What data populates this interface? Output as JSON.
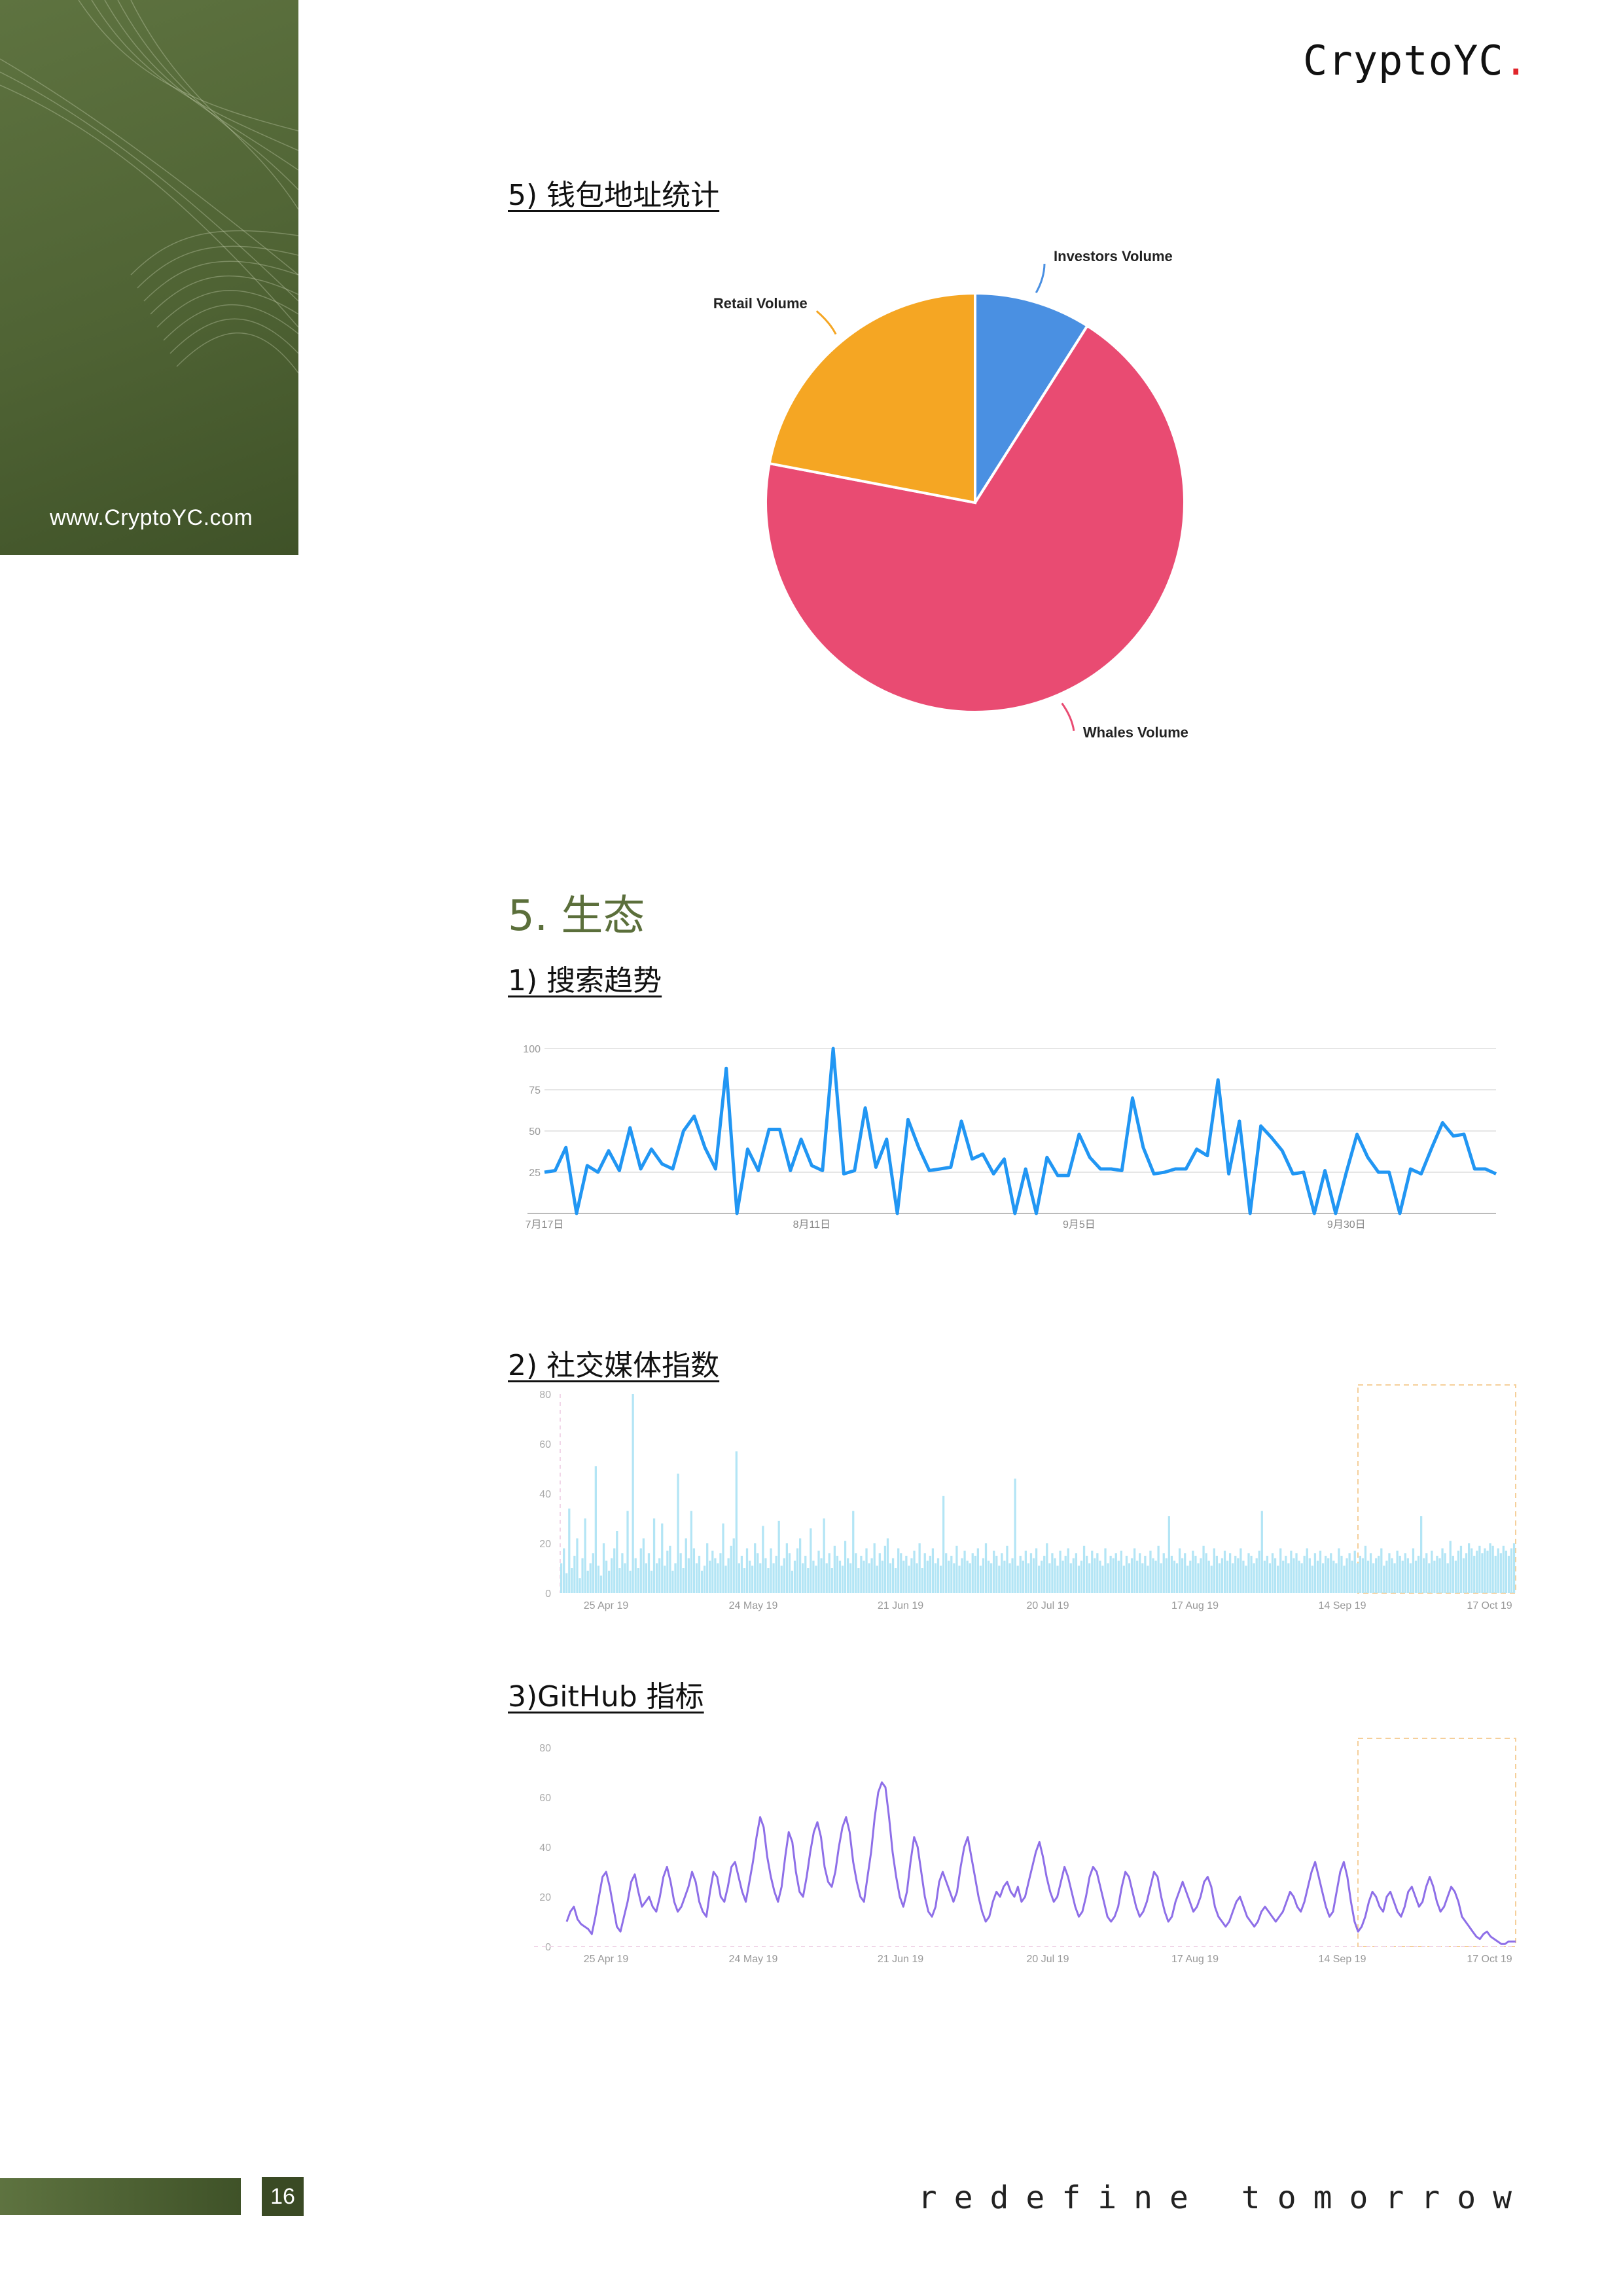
{
  "header": {
    "logo_text": "CryptoYC",
    "logo_dot": "."
  },
  "sidebar": {
    "url": "www.CryptoYC.com"
  },
  "sections": {
    "wallet_heading": "5) 钱包地址统计",
    "ecosystem_title": "5. 生态",
    "search_heading": "1) 搜索趋势",
    "social_heading": "2) 社交媒体指数",
    "github_heading": "3)GitHub 指标"
  },
  "footer": {
    "page_number": "16",
    "tagline": "redefine tomorrow"
  },
  "colors": {
    "brand_green": "#5b6f3b",
    "investors": "#4a90e2",
    "whales": "#e94b72",
    "retail": "#f5a623",
    "search_line": "#2196f3",
    "social_bars": "#b3e5f5",
    "github_line": "#8e6fe8",
    "highlight_box": "#f5cf9a"
  },
  "chart_data": [
    {
      "type": "pie",
      "title": "",
      "slices": [
        {
          "label": "Investors Volume",
          "value": 9
        },
        {
          "label": "Whales Volume",
          "value": 69
        },
        {
          "label": "Retail Volume",
          "value": 22
        }
      ],
      "legend": "none"
    },
    {
      "type": "line",
      "title": "",
      "xlabel": "",
      "ylabel": "",
      "ylim": [
        0,
        100
      ],
      "yticks": [
        "100",
        "75",
        "50",
        "25"
      ],
      "xtick_labels": [
        {
          "label": "7月17日",
          "index": 0
        },
        {
          "label": "8月11日",
          "index": 25
        },
        {
          "label": "9月5日",
          "index": 50
        },
        {
          "label": "9月30日",
          "index": 75
        }
      ],
      "grid": true,
      "series": [
        {
          "values": [
            25,
            26,
            40,
            0,
            29,
            25,
            38,
            26,
            52,
            27,
            39,
            30,
            27,
            50,
            59,
            40,
            27,
            88,
            0,
            39,
            26,
            51,
            51,
            26,
            45,
            29,
            26,
            100,
            24,
            26,
            64,
            28,
            45,
            0,
            57,
            40,
            26,
            27,
            28,
            56,
            33,
            36,
            24,
            33,
            0,
            27,
            0,
            34,
            23,
            23,
            48,
            34,
            27,
            27,
            26,
            70,
            40,
            24,
            25,
            27,
            27,
            39,
            35,
            81,
            24,
            56,
            0,
            53,
            46,
            38,
            24,
            25,
            0,
            26,
            0,
            25,
            48,
            34,
            25,
            25,
            0,
            27,
            24,
            40,
            55,
            47,
            48,
            27,
            27,
            24
          ]
        }
      ]
    },
    {
      "type": "bar",
      "title": "",
      "ylim": [
        0,
        80
      ],
      "yticks": [
        "80",
        "60",
        "40",
        "20",
        "0"
      ],
      "xtick_labels": [
        "25 Apr 19",
        "24 May 19",
        "21 Jun 19",
        "20 Jul 19",
        "17 Aug 19",
        "14 Sep 19",
        "17 Oct 19"
      ],
      "series": [
        {
          "values": [
            12,
            18,
            8,
            34,
            10,
            15,
            22,
            6,
            14,
            30,
            9,
            12,
            16,
            51,
            11,
            7,
            20,
            13,
            9,
            14,
            18,
            25,
            10,
            16,
            12,
            33,
            9,
            80,
            14,
            10,
            18,
            22,
            12,
            16,
            9,
            30,
            12,
            14,
            28,
            11,
            17,
            19,
            9,
            12,
            48,
            16,
            10,
            22,
            14,
            33,
            18,
            12,
            15,
            9,
            11,
            20,
            13,
            17,
            14,
            12,
            16,
            28,
            11,
            14,
            19,
            22,
            57,
            12,
            15,
            10,
            18,
            13,
            11,
            20,
            16,
            12,
            27,
            14,
            10,
            18,
            12,
            15,
            29,
            11,
            14,
            20,
            16,
            9,
            13,
            18,
            22,
            12,
            15,
            10,
            26,
            13,
            11,
            17,
            14,
            30,
            12,
            16,
            10,
            19,
            15,
            13,
            11,
            21,
            14,
            12,
            33,
            16,
            10,
            15,
            13,
            18,
            12,
            14,
            20,
            11,
            16,
            13,
            19,
            22,
            12,
            14,
            10,
            18,
            16,
            13,
            15,
            11,
            14,
            17,
            12,
            20,
            10,
            16,
            13,
            15,
            18,
            12,
            14,
            11,
            39,
            16,
            13,
            15,
            12,
            19,
            11,
            14,
            17,
            13,
            12,
            16,
            15,
            18,
            11,
            14,
            20,
            13,
            12,
            17,
            15,
            11,
            16,
            13,
            19,
            12,
            14,
            46,
            11,
            15,
            13,
            17,
            12,
            16,
            14,
            18,
            11,
            13,
            15,
            20,
            12,
            16,
            14,
            11,
            17,
            13,
            15,
            18,
            12,
            14,
            16,
            11,
            13,
            19,
            15,
            12,
            17,
            14,
            16,
            13,
            11,
            18,
            12,
            15,
            14,
            16,
            13,
            17,
            11,
            15,
            12,
            14,
            18,
            13,
            16,
            12,
            15,
            11,
            17,
            14,
            13,
            19,
            12,
            16,
            14,
            31,
            15,
            13,
            12,
            18,
            14,
            16,
            11,
            13,
            17,
            15,
            12,
            14,
            19,
            16,
            13,
            11,
            18,
            15,
            12,
            14,
            17,
            13,
            16,
            12,
            15,
            14,
            18,
            13,
            11,
            16,
            15,
            12,
            14,
            17,
            33,
            13,
            15,
            12,
            16,
            14,
            11,
            18,
            13,
            15,
            12,
            17,
            14,
            16,
            13,
            12,
            15,
            18,
            14,
            11,
            16,
            13,
            17,
            12,
            15,
            14,
            16,
            13,
            12,
            18,
            15,
            11,
            14,
            16,
            13,
            17,
            12,
            15,
            14,
            19,
            13,
            16,
            12,
            14,
            15,
            18,
            11,
            13,
            16,
            14,
            12,
            17,
            15,
            13,
            16,
            14,
            12,
            18,
            13,
            15,
            31,
            14,
            16,
            12,
            17,
            13,
            15,
            14,
            18,
            16,
            12,
            21,
            15,
            13,
            17,
            19,
            14,
            16,
            20,
            18,
            15,
            17,
            19,
            16,
            18,
            17,
            20,
            19,
            15,
            18,
            16,
            19,
            17,
            15,
            18,
            20
          ]
        }
      ],
      "highlight_region": {
        "from_label": "14 Sep 19",
        "to_label": "17 Oct 19"
      }
    },
    {
      "type": "line",
      "title": "",
      "ylim": [
        0,
        80
      ],
      "yticks": [
        "80",
        "60",
        "40",
        "20",
        "0"
      ],
      "xtick_labels": [
        "25 Apr 19",
        "24 May 19",
        "21 Jun 19",
        "20 Jul 19",
        "17 Aug 19",
        "14 Sep 19",
        "17 Oct 19"
      ],
      "series": [
        {
          "values": [
            10,
            14,
            16,
            11,
            9,
            8,
            7,
            5,
            12,
            20,
            28,
            30,
            24,
            16,
            8,
            6,
            12,
            18,
            26,
            29,
            22,
            16,
            18,
            20,
            16,
            14,
            20,
            28,
            32,
            26,
            18,
            14,
            16,
            20,
            24,
            30,
            26,
            18,
            14,
            12,
            22,
            30,
            28,
            20,
            18,
            24,
            32,
            34,
            28,
            22,
            18,
            26,
            34,
            44,
            52,
            48,
            36,
            28,
            22,
            18,
            24,
            36,
            46,
            42,
            30,
            22,
            20,
            28,
            38,
            46,
            50,
            44,
            32,
            26,
            24,
            30,
            40,
            48,
            52,
            46,
            34,
            26,
            20,
            18,
            28,
            38,
            52,
            62,
            66,
            64,
            52,
            38,
            28,
            20,
            16,
            22,
            34,
            44,
            40,
            30,
            20,
            14,
            12,
            16,
            26,
            30,
            26,
            22,
            18,
            22,
            32,
            40,
            44,
            36,
            28,
            20,
            14,
            10,
            12,
            18,
            22,
            20,
            24,
            26,
            22,
            20,
            24,
            18,
            20,
            26,
            32,
            38,
            42,
            36,
            28,
            22,
            18,
            20,
            26,
            32,
            28,
            22,
            16,
            12,
            14,
            20,
            28,
            32,
            30,
            24,
            18,
            12,
            10,
            12,
            16,
            24,
            30,
            28,
            22,
            16,
            12,
            14,
            18,
            24,
            30,
            28,
            20,
            14,
            10,
            12,
            18,
            22,
            26,
            22,
            18,
            14,
            16,
            20,
            26,
            28,
            24,
            16,
            12,
            10,
            8,
            10,
            14,
            18,
            20,
            16,
            12,
            10,
            8,
            10,
            14,
            16,
            14,
            12,
            10,
            12,
            14,
            18,
            22,
            20,
            16,
            14,
            18,
            24,
            30,
            34,
            28,
            22,
            16,
            12,
            14,
            22,
            30,
            34,
            28,
            18,
            10,
            6,
            8,
            12,
            18,
            22,
            20,
            16,
            14,
            20,
            22,
            18,
            14,
            12,
            16,
            22,
            24,
            20,
            16,
            18,
            24,
            28,
            24,
            18,
            14,
            16,
            20,
            24,
            22,
            18,
            12,
            10,
            8,
            6,
            4,
            3,
            5,
            6,
            4,
            3,
            2,
            1,
            1,
            2,
            2,
            2
          ]
        }
      ],
      "highlight_region": {
        "from_label": "14 Sep 19",
        "to_label": "17 Oct 19"
      }
    }
  ]
}
